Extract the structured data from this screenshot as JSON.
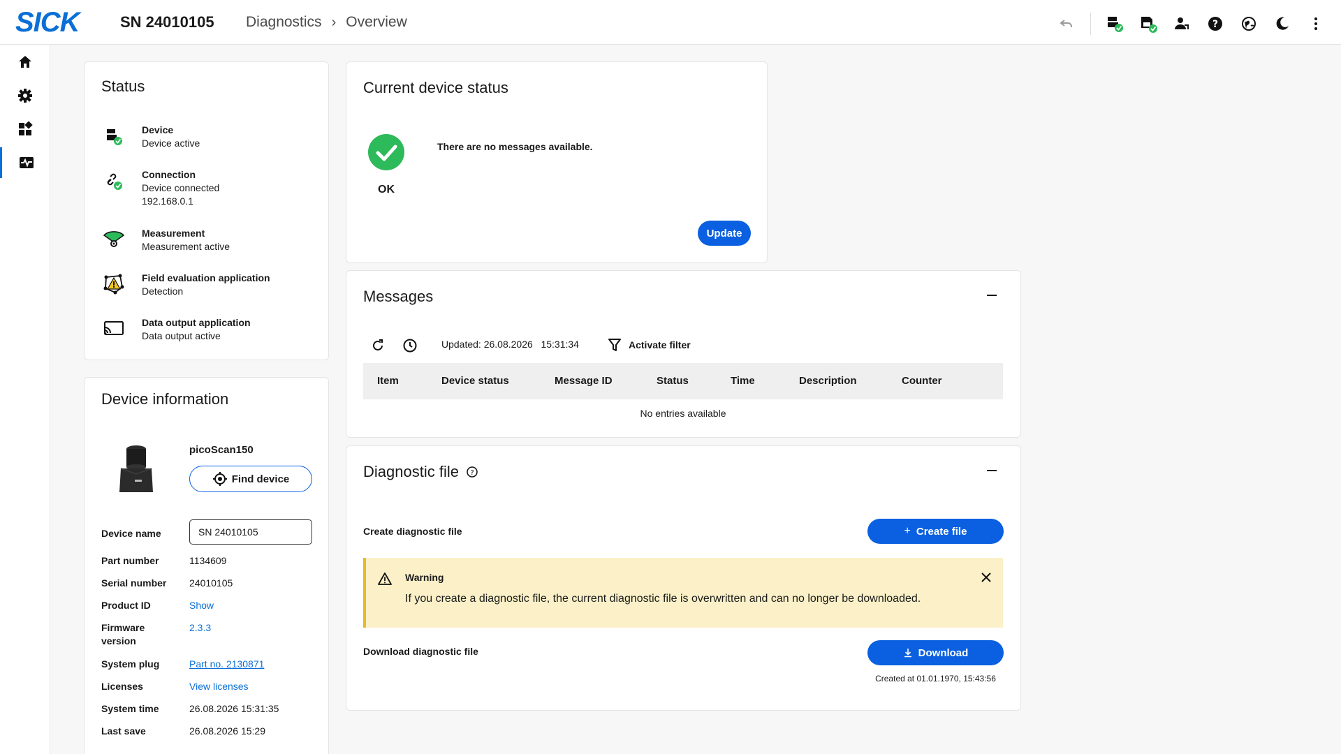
{
  "header": {
    "logo": "SICK",
    "serial": "SN 24010105",
    "breadcrumb": [
      "Diagnostics",
      "Overview"
    ],
    "breadcrumb_sep": "›"
  },
  "status": {
    "title": "Status",
    "items": [
      {
        "title": "Device",
        "lines": [
          "Device active"
        ],
        "icon": "device-icon"
      },
      {
        "title": "Connection",
        "lines": [
          "Device connected",
          "192.168.0.1"
        ],
        "icon": "link-icon"
      },
      {
        "title": "Measurement",
        "lines": [
          "Measurement active"
        ],
        "icon": "measurement-icon"
      },
      {
        "title": "Field evaluation application",
        "lines": [
          "Detection"
        ],
        "icon": "field-evaluation-icon"
      },
      {
        "title": "Data output application",
        "lines": [
          "Data output active"
        ],
        "icon": "data-output-icon"
      }
    ]
  },
  "device_info": {
    "title": "Device information",
    "model": "picoScan150",
    "find_device_label": "Find device",
    "device_name_label": "Device name",
    "device_name_value": "SN 24010105",
    "rows": [
      {
        "label": "Part number",
        "value": "1134609"
      },
      {
        "label": "Serial number",
        "value": "24010105"
      },
      {
        "label": "Product ID",
        "value": "Show"
      },
      {
        "label": "Firmware version",
        "value": "2.3.3"
      },
      {
        "label": "System plug",
        "value": "Part no. 2130871"
      },
      {
        "label": "Licenses",
        "value": "View licenses"
      },
      {
        "label": "System time",
        "value": "26.08.2026 15:31:35"
      },
      {
        "label": "Last save",
        "value": "26.08.2026 15:29"
      }
    ]
  },
  "current_status": {
    "title": "Current device status",
    "state": "OK",
    "message": "There are no messages available.",
    "update_label": "Update"
  },
  "messages": {
    "title": "Messages",
    "updated_text": "Updated: 26.08.2026   15:31:34",
    "filter_label": "Activate filter",
    "columns": [
      "Item",
      "Device status",
      "Message ID",
      "Status",
      "Time",
      "Description",
      "Counter"
    ],
    "empty_text": "No entries available"
  },
  "diag_file": {
    "title": "Diagnostic file",
    "create_label": "Create diagnostic file",
    "create_button": "Create file",
    "warning_title": "Warning",
    "warning_text": "If you create a diagnostic file, the current diagnostic file is overwritten and can no longer be downloaded.",
    "download_label": "Download diagnostic file",
    "download_button": "Download",
    "created_at": "Created at 01.01.1970, 15:43:56"
  },
  "colors": {
    "accent": "#0a60e0",
    "ok_green": "#2dba5a",
    "warning_bg": "#fbf0c7"
  }
}
